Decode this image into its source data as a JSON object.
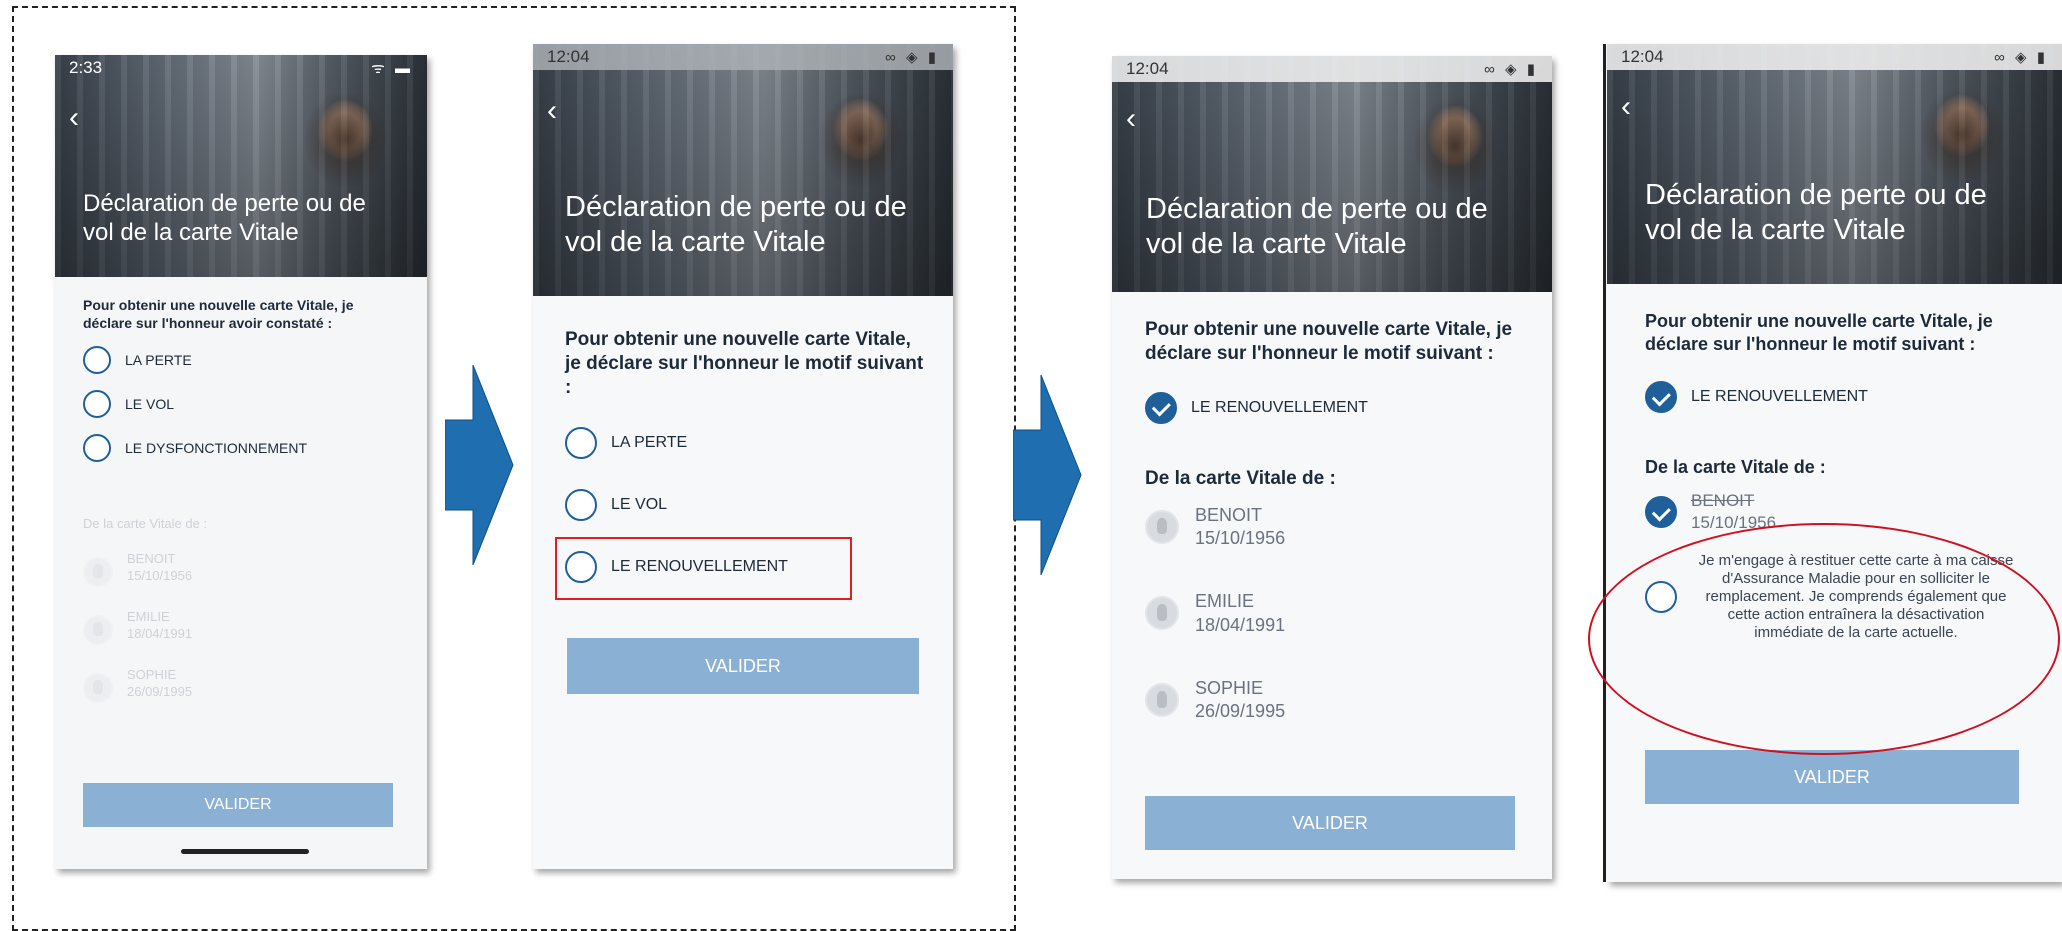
{
  "phone1": {
    "status_time": "2:33",
    "status_icons": "ᯤ ▬",
    "title": "Déclaration de perte ou de vol de la carte Vitale",
    "intro": "Pour obtenir une nouvelle carte Vitale, je déclare sur l'honneur avoir constaté :",
    "options": [
      "LA PERTE",
      "LE VOL",
      "LE DYSFONCTIONNEMENT"
    ],
    "section": "De la carte Vitale de :",
    "people": [
      {
        "name": "BENOIT",
        "date": "15/10/1956"
      },
      {
        "name": "EMILIE",
        "date": "18/04/1991"
      },
      {
        "name": "SOPHIE",
        "date": "26/09/1995"
      }
    ],
    "button": "VALIDER"
  },
  "phone2": {
    "status_time": "12:04",
    "status_icons": "∞ ◈ ▮",
    "title": "Déclaration de perte ou de vol de la carte Vitale",
    "intro": "Pour obtenir une nouvelle carte Vitale, je déclare sur l'honneur le motif suivant :",
    "options": [
      "LA PERTE",
      "LE VOL",
      "LE RENOUVELLEMENT"
    ],
    "button": "VALIDER"
  },
  "phone3": {
    "status_time": "12:04",
    "status_icons": "∞ ◈ ▮",
    "title": "Déclaration de perte ou de vol de la carte Vitale",
    "intro": "Pour obtenir une nouvelle carte Vitale, je déclare sur l'honneur le motif suivant :",
    "selected_option": "LE RENOUVELLEMENT",
    "section": "De la carte Vitale de :",
    "people": [
      {
        "name": "BENOIT",
        "date": "15/10/1956"
      },
      {
        "name": "EMILIE",
        "date": "18/04/1991"
      },
      {
        "name": "SOPHIE",
        "date": "26/09/1995"
      }
    ],
    "button": "VALIDER"
  },
  "phone4": {
    "status_time": "12:04",
    "status_icons": "∞ ◈ ▮",
    "title": "Déclaration de perte ou de vol de la carte Vitale",
    "intro": "Pour obtenir une nouvelle carte Vitale, je déclare sur l'honneur le motif suivant :",
    "selected_option": "LE RENOUVELLEMENT",
    "section": "De la carte Vitale de :",
    "person": {
      "name": "BENOIT",
      "date": "15/10/1956"
    },
    "engagement": "Je m'engage à restituer cette carte à ma caisse d'Assurance Maladie pour en solliciter le remplacement. Je comprends également que cette action entraînera la désactivation immédiate de la carte actuelle.",
    "button": "VALIDER"
  },
  "colors": {
    "accent": "#1f5f9a",
    "button": "#8ab0d3",
    "arrow": "#1f6fb0",
    "highlight": "#e02020"
  }
}
